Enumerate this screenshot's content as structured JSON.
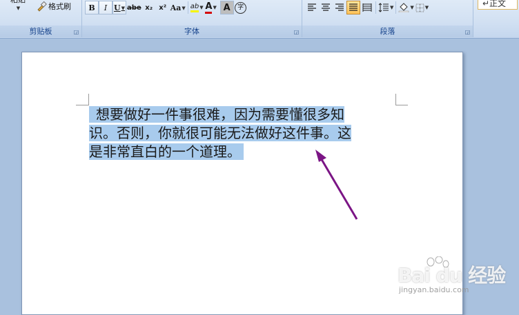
{
  "ribbon": {
    "clipboard": {
      "paste_label": "粘贴",
      "format_painter_label": "格式刷",
      "group_label": "剪贴板"
    },
    "font": {
      "bold": "B",
      "italic": "I",
      "underline": "U",
      "strikethrough": "abe",
      "subscript": "x₂",
      "superscript": "x²",
      "change_case": "Aa",
      "highlight": "ab",
      "font_color": "A",
      "char_shading": "A",
      "enclose_char": "字",
      "group_label": "字体"
    },
    "paragraph": {
      "group_label": "段落"
    },
    "styles": {
      "normal_label": "↵正文"
    }
  },
  "document": {
    "paragraph_lines": [
      "想要做好一件事很难，因为需要懂很多知",
      "识。否则，你就很可能无法做好这件事。这",
      "是非常直白的一个道理。"
    ]
  },
  "watermark": {
    "brand": "Bai du 经验",
    "url": "jingyan.baidu.com"
  },
  "colors": {
    "selection": "#a8cbed",
    "arrow": "#7b1585",
    "ribbon_text": "#15428b"
  }
}
